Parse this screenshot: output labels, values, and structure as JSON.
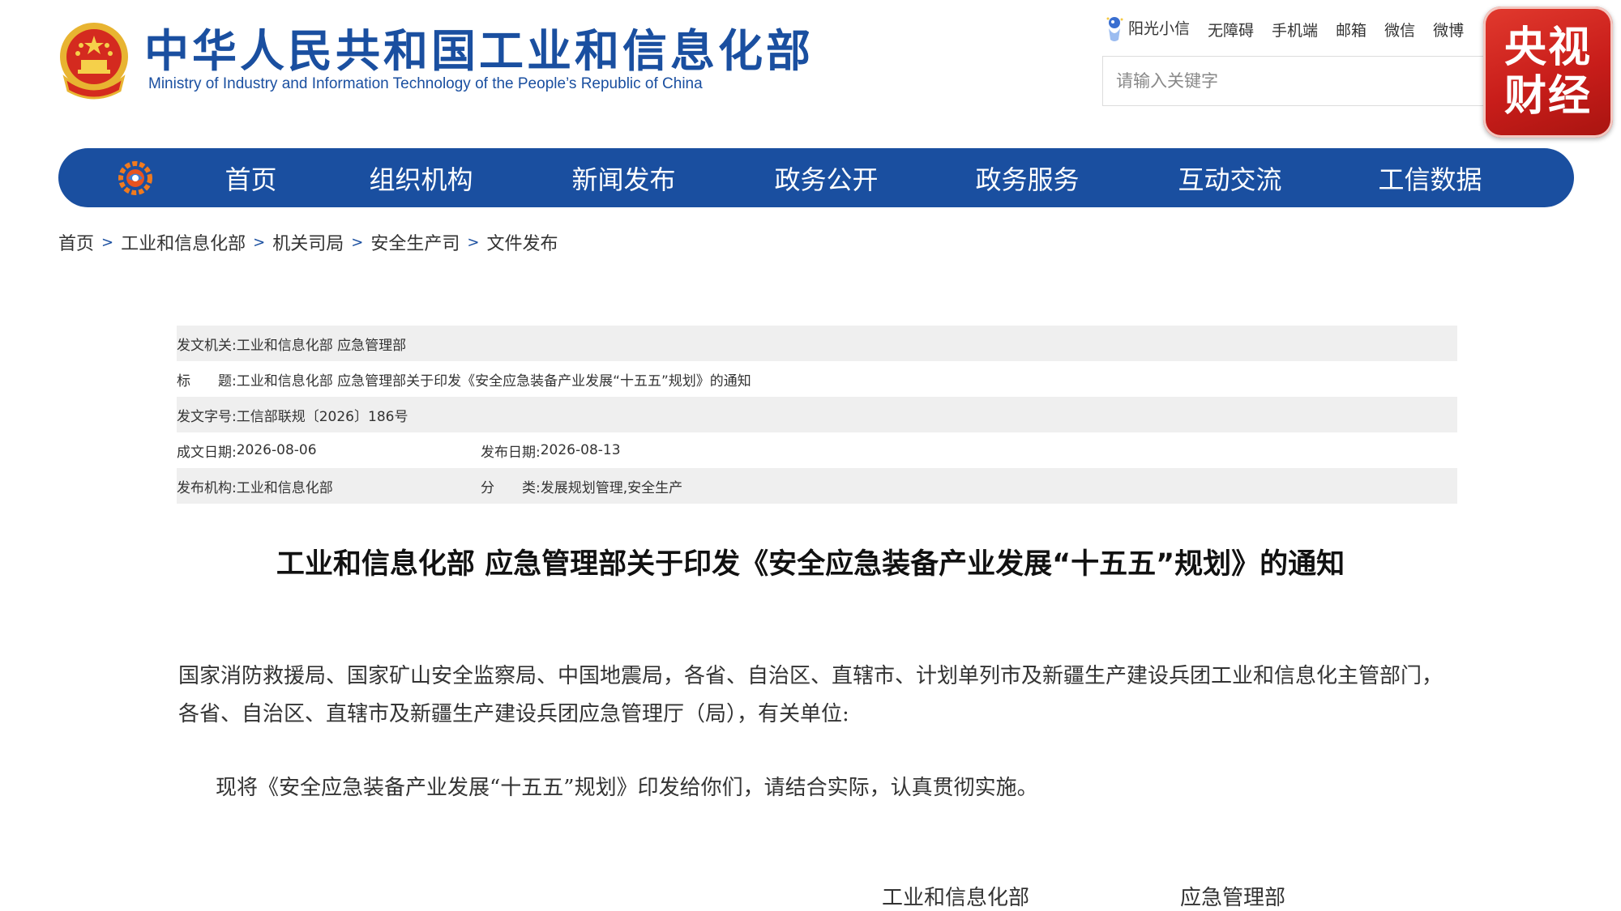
{
  "header": {
    "title_cn": "中华人民共和国工业和信息化部",
    "title_en": "Ministry of Industry and Information Technology of the People’s Republic of China",
    "emblem_icon": "national-emblem-icon"
  },
  "top_links": [
    "阳光小信",
    "无障碍",
    "手机端",
    "邮箱",
    "微信",
    "微博"
  ],
  "search": {
    "placeholder": "请输入关键字"
  },
  "watermark": {
    "line1": "央视",
    "line2": "财经"
  },
  "nav": {
    "logo_icon": "miit-logo-icon",
    "items": [
      "首页",
      "组织机构",
      "新闻发布",
      "政务公开",
      "政务服务",
      "互动交流",
      "工信数据"
    ]
  },
  "breadcrumb": [
    "首页",
    "工业和信息化部",
    "机关司局",
    "安全生产司",
    "文件发布"
  ],
  "breadcrumb_sep": ">",
  "info": {
    "issuer_label": "发文机关:",
    "issuer": "工业和信息化部 应急管理部",
    "title_label": "标　　题:",
    "title": "工业和信息化部 应急管理部关于印发《安全应急装备产业发展“十五五”规划》的通知",
    "doc_no_label": "发文字号:",
    "doc_no": "工信部联规〔2026〕186号",
    "written_date_label": "成文日期:",
    "written_date": "2026-08-06",
    "publish_date_label": "发布日期:",
    "publish_date": "2026-08-13",
    "publisher_label": "发布机构:",
    "publisher": "工业和信息化部",
    "category_label": "分　　类:",
    "category": "发展规划管理,安全生产"
  },
  "document": {
    "title": "工业和信息化部 应急管理部关于印发《安全应急装备产业发展“十五五”规划》的通知",
    "recipients_line1": "国家消防救援局、国家矿山安全监察局、中国地震局，各省、自治区、直辖市、计划单列市及新疆生产建设兵团工业和信息化主管部门，",
    "recipients_line2": "各省、自治区、直辖市及新疆生产建设兵团应急管理厅（局），有关单位:",
    "body": "现将《安全应急装备产业发展“十五五”规划》印发给你们，请结合实际，认真贯彻实施。",
    "signature1": "工业和信息化部",
    "signature2": "应急管理部"
  },
  "colors": {
    "brand_blue": "#1a4fa0",
    "badge_red": "#c81d1a",
    "row_shade": "#efefef"
  }
}
